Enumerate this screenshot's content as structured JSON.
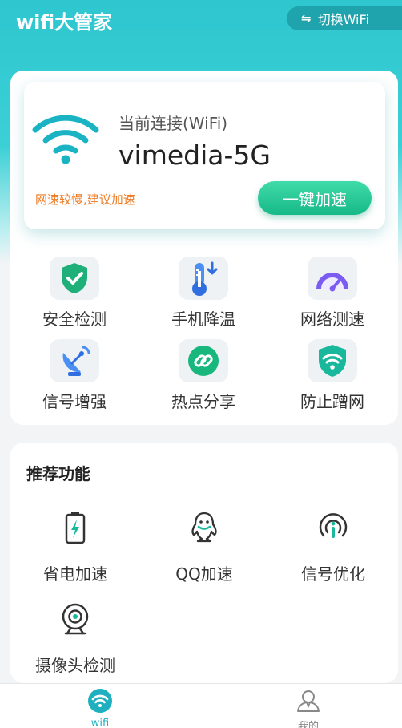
{
  "header": {
    "app_title": "wifi大管家",
    "switch_label": "切换WiFi",
    "switch_icon": "swap-arrows-icon"
  },
  "connection": {
    "label": "当前连接(WiFi)",
    "ssid": "vimedia-5G",
    "tip": "网速较慢,建议加速",
    "boost_label": "一键加速"
  },
  "tools": [
    {
      "label": "安全检测",
      "icon": "shield-check-icon"
    },
    {
      "label": "手机降温",
      "icon": "thermometer-icon"
    },
    {
      "label": "网络测速",
      "icon": "speedometer-icon"
    },
    {
      "label": "信号增强",
      "icon": "satellite-dish-icon"
    },
    {
      "label": "热点分享",
      "icon": "link-icon"
    },
    {
      "label": "防止蹭网",
      "icon": "wifi-shield-icon"
    }
  ],
  "recommend": {
    "title": "推荐功能",
    "items": [
      {
        "label": "省电加速",
        "icon": "battery-bolt-icon"
      },
      {
        "label": "QQ加速",
        "icon": "qq-penguin-icon"
      },
      {
        "label": "信号优化",
        "icon": "signal-icon"
      },
      {
        "label": "摄像头检测",
        "icon": "camera-icon"
      }
    ]
  },
  "nav": {
    "items": [
      {
        "label": "wifi",
        "icon": "wifi-icon",
        "active": true
      },
      {
        "label": "我的",
        "icon": "user-icon",
        "active": false
      }
    ]
  },
  "colors": {
    "brand": "#2ec6cf",
    "accent_green": "#17b987",
    "warning": "#ef7a22",
    "nav_active": "#1fb0c0",
    "nav_inactive": "#888888"
  }
}
